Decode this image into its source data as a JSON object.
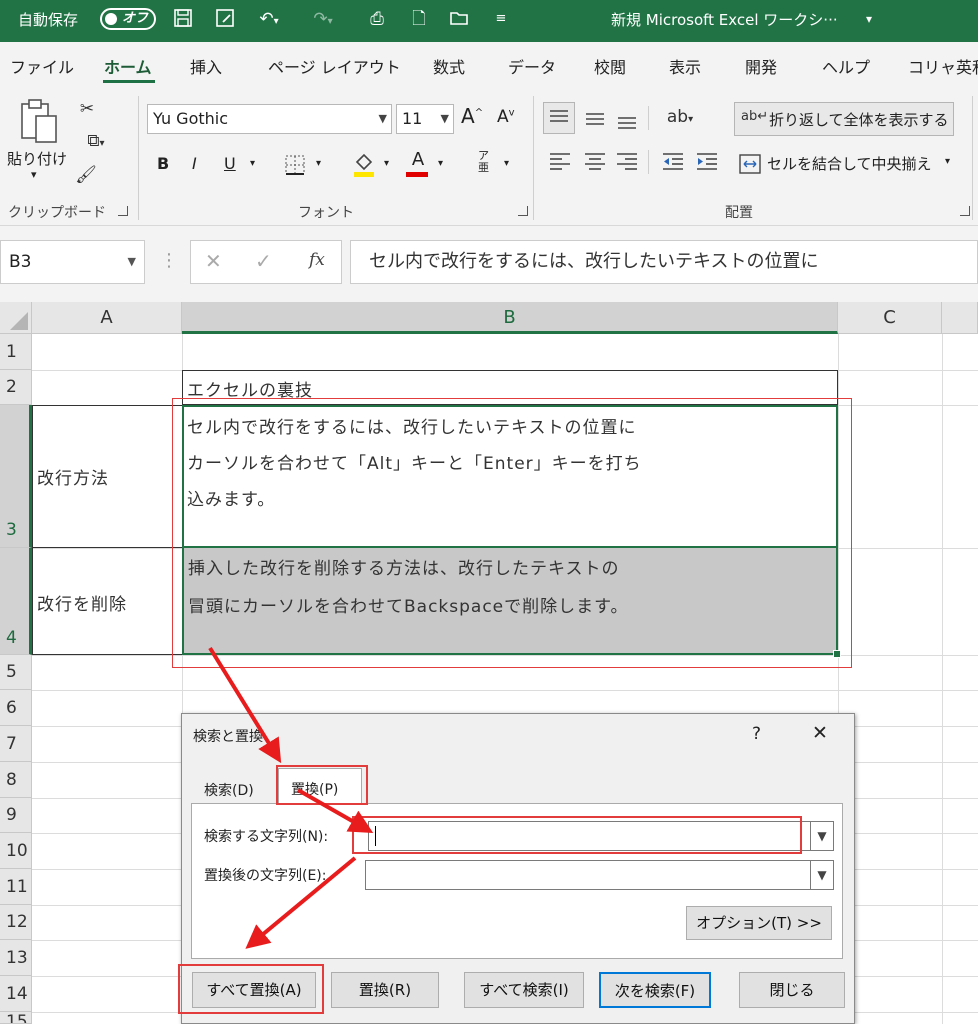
{
  "titlebar": {
    "autosave_label": "自動保存",
    "autosave_state": "オフ",
    "doc_title": "新規 Microsoft Excel ワークシ···",
    "title_dropdown": "▾"
  },
  "tabs": [
    "ファイル",
    "ホーム",
    "挿入",
    "ページ レイアウト",
    "数式",
    "データ",
    "校閲",
    "表示",
    "開発",
    "ヘルプ",
    "コリャ英和"
  ],
  "ribbon": {
    "paste_label": "貼り付け",
    "clipboard_label": "クリップボード",
    "font_label": "フォント",
    "alignment_label": "配置",
    "font_name": "Yu Gothic",
    "font_size": "11",
    "bold": "B",
    "italic": "I",
    "underline": "U",
    "font_grow": "A",
    "font_shrink": "A",
    "wrap_text": "折り返して全体を表示する",
    "merge_center": "セルを結合して中央揃え"
  },
  "formula_bar": {
    "name_box": "B3",
    "fx": "fx",
    "content": "セル内で改行をするには、改行したいテキストの位置に"
  },
  "grid": {
    "columns": [
      "A",
      "B",
      "C"
    ],
    "rows": [
      "1",
      "2",
      "3",
      "4",
      "5",
      "6",
      "7",
      "8",
      "9",
      "10",
      "11",
      "12",
      "13",
      "14",
      "15"
    ],
    "cells": {
      "B2": "エクセルの裏技",
      "A3": "改行方法",
      "B3_lines": [
        "セル内で改行をするには、改行したいテキストの位置に",
        "カーソルを合わせて「Alt」キーと「Enter」キーを打ち",
        "込みます。"
      ],
      "A4": "改行を削除",
      "B4_lines": [
        "挿入した改行を削除する方法は、改行したテキストの",
        "冒頭にカーソルを合わせてBackspaceで削除します。"
      ]
    }
  },
  "dialog": {
    "title": "検索と置換",
    "help": "?",
    "close": "✕",
    "tab_find": "検索(D)",
    "tab_replace": "置換(P)",
    "find_label": "検索する文字列(N):",
    "find_value": "",
    "replace_label": "置換後の文字列(E):",
    "replace_value": "",
    "options_button": "オプション(T) >>",
    "replace_all_button": "すべて置換(A)",
    "replace_button": "置換(R)",
    "find_all_button": "すべて検索(I)",
    "find_next_button": "次を検索(F)",
    "close_button": "閉じる"
  },
  "colors": {
    "excel_green": "#217346",
    "annotation_red": "#e23c3c",
    "selected_fill": "#c8c8c8"
  }
}
